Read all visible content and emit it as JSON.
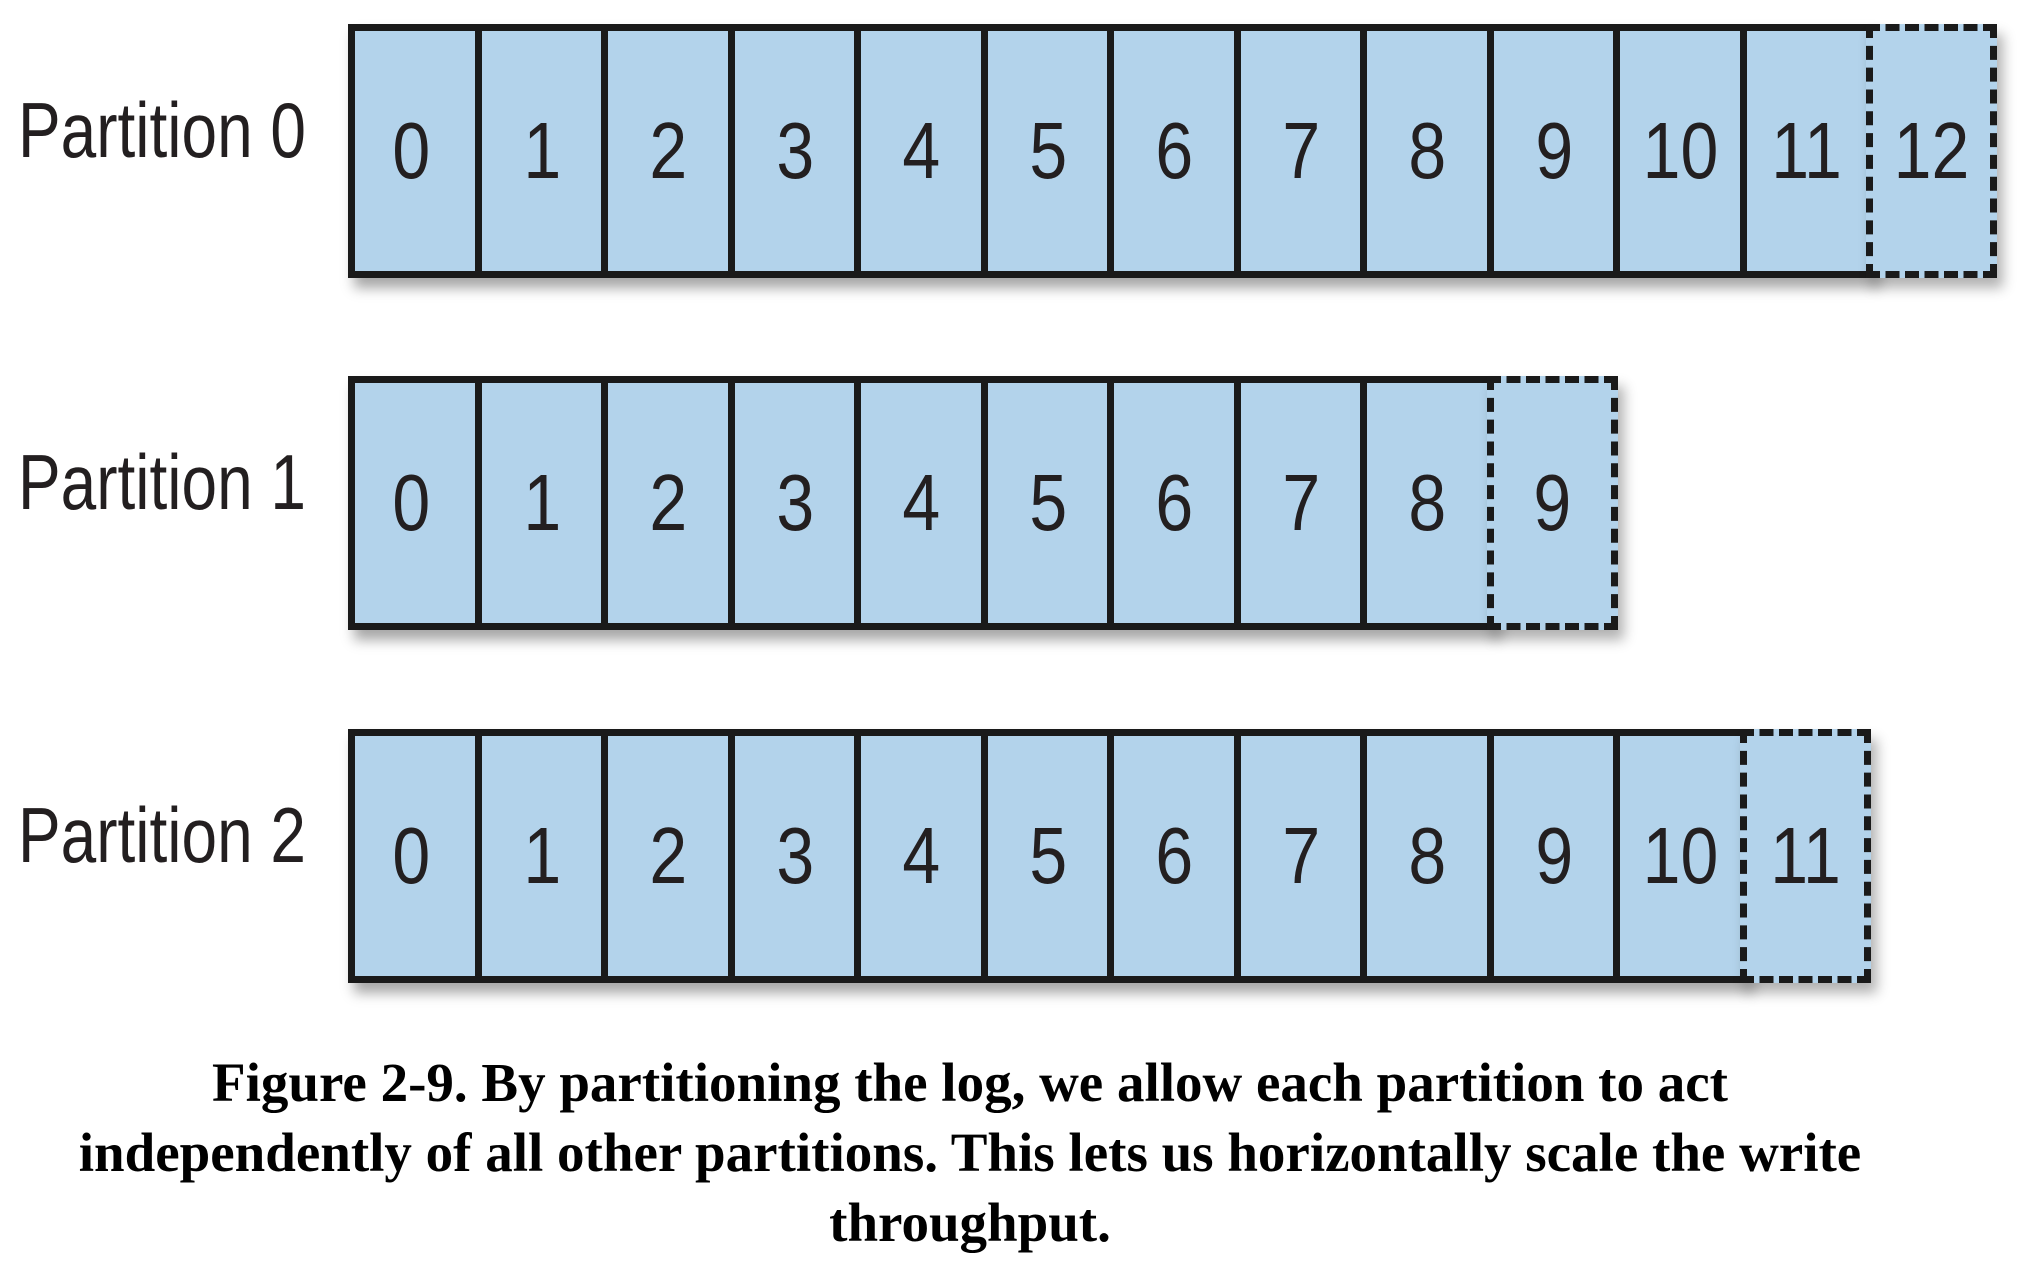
{
  "diagram": {
    "partitions": [
      {
        "label": "Partition 0",
        "offsets": [
          "0",
          "1",
          "2",
          "3",
          "4",
          "5",
          "6",
          "7",
          "8",
          "9",
          "10",
          "11"
        ],
        "next_offset": "12"
      },
      {
        "label": "Partition 1",
        "offsets": [
          "0",
          "1",
          "2",
          "3",
          "4",
          "5",
          "6",
          "7",
          "8"
        ],
        "next_offset": "9"
      },
      {
        "label": "Partition 2",
        "offsets": [
          "0",
          "1",
          "2",
          "3",
          "4",
          "5",
          "6",
          "7",
          "8",
          "9",
          "10"
        ],
        "next_offset": "11"
      }
    ],
    "colors": {
      "cell_fill": "#b3d3eb",
      "border": "#1a1a1a",
      "text": "#231f20"
    }
  },
  "caption": "Figure 2-9. By partitioning the log, we allow each partition to act independently of all other partitions. This lets us horizontally scale the write throughput."
}
